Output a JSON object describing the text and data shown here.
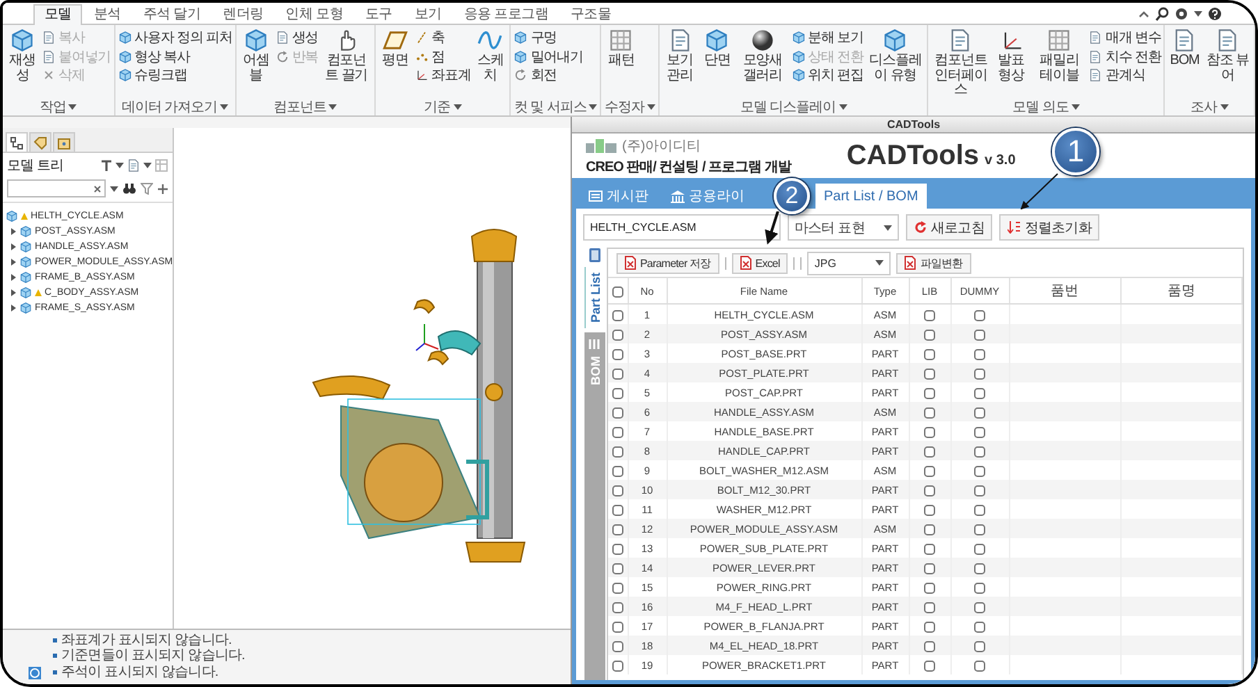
{
  "ribbon": {
    "tabs": [
      {
        "label": "모델",
        "selected": true
      },
      {
        "label": "분석",
        "selected": false
      },
      {
        "label": "주석 달기",
        "selected": false
      },
      {
        "label": "렌더링",
        "selected": false
      },
      {
        "label": "인체 모형",
        "selected": false
      },
      {
        "label": "도구",
        "selected": false
      },
      {
        "label": "보기",
        "selected": false
      },
      {
        "label": "응용 프로그램",
        "selected": false
      },
      {
        "label": "구조물",
        "selected": false
      }
    ],
    "groups": [
      {
        "label": "작업",
        "items": [
          {
            "kind": "large",
            "label": "재생성",
            "disabled": false
          },
          {
            "kind": "stack",
            "items": [
              {
                "label": "복사",
                "disabled": true
              },
              {
                "label": "붙여넣기",
                "disabled": true
              },
              {
                "label": "삭제",
                "disabled": true
              }
            ]
          }
        ]
      },
      {
        "label": "데이터 가져오기",
        "items": [
          {
            "kind": "stack",
            "items": [
              {
                "label": "사용자 정의 피처",
                "disabled": false
              },
              {
                "label": "형상 복사",
                "disabled": false
              },
              {
                "label": "슈링크랩",
                "disabled": false
              }
            ]
          }
        ]
      },
      {
        "label": "컴포넌트",
        "items": [
          {
            "kind": "large",
            "label": "어셈블",
            "disabled": false
          },
          {
            "kind": "stack",
            "items": [
              {
                "label": "생성",
                "disabled": false
              },
              {
                "label": "반복",
                "disabled": true
              }
            ]
          },
          {
            "kind": "large",
            "label": "컴포넌트 끌기",
            "disabled": false
          }
        ]
      },
      {
        "label": "기준",
        "items": [
          {
            "kind": "large",
            "label": "평면",
            "disabled": false
          },
          {
            "kind": "stack",
            "items": [
              {
                "label": "축",
                "disabled": false
              },
              {
                "label": "점",
                "disabled": false
              },
              {
                "label": "좌표계",
                "disabled": false
              }
            ]
          },
          {
            "kind": "large",
            "label": "스케치",
            "disabled": false
          }
        ]
      },
      {
        "label": "컷 및 서피스",
        "items": [
          {
            "kind": "stack",
            "items": [
              {
                "label": "구멍",
                "disabled": false
              },
              {
                "label": "밀어내기",
                "disabled": false
              },
              {
                "label": "회전",
                "disabled": false
              }
            ]
          }
        ]
      },
      {
        "label": "수정자",
        "items": [
          {
            "kind": "large",
            "label": "패턴",
            "disabled": false
          }
        ]
      },
      {
        "label": "모델 디스플레이",
        "items": [
          {
            "kind": "large",
            "label": "보기 관리",
            "disabled": false
          },
          {
            "kind": "large",
            "label": "단면",
            "disabled": false
          },
          {
            "kind": "large",
            "label": "모양새 갤러리",
            "disabled": false
          },
          {
            "kind": "stack",
            "items": [
              {
                "label": "분해 보기",
                "disabled": false
              },
              {
                "label": "상태 전환",
                "disabled": true
              },
              {
                "label": "위치 편집",
                "disabled": false
              }
            ]
          },
          {
            "kind": "large",
            "label": "디스플레이 유형",
            "disabled": false
          }
        ]
      },
      {
        "label": "모델 의도",
        "items": [
          {
            "kind": "large",
            "label": "컴포넌트 인터페이스",
            "disabled": false
          },
          {
            "kind": "large",
            "label": "발표 형상",
            "disabled": false
          },
          {
            "kind": "large",
            "label": "패밀리 테이블",
            "disabled": false
          },
          {
            "kind": "stack",
            "items": [
              {
                "label": "매개 변수",
                "disabled": false
              },
              {
                "label": "치수 전환",
                "disabled": false
              },
              {
                "label": "관계식",
                "disabled": false
              }
            ]
          }
        ]
      },
      {
        "label": "조사",
        "items": [
          {
            "kind": "large",
            "label": "BOM",
            "disabled": false
          },
          {
            "kind": "large",
            "label": "참조 뷰어",
            "disabled": false
          }
        ]
      }
    ]
  },
  "model_tree": {
    "panel_tabs": [
      {
        "selected": true
      },
      {
        "selected": false
      },
      {
        "selected": false
      }
    ],
    "title": "모델 트리",
    "root": {
      "label": "HELTH_CYCLE.ASM",
      "warning": true,
      "children": [
        {
          "label": "POST_ASSY.ASM",
          "warning": false,
          "expanded": false
        },
        {
          "label": "HANDLE_ASSY.ASM",
          "warning": false,
          "expanded": false
        },
        {
          "label": "POWER_MODULE_ASSY.ASM",
          "warning": false,
          "expanded": false
        },
        {
          "label": "FRAME_B_ASSY.ASM",
          "warning": false,
          "expanded": false
        },
        {
          "label": "C_BODY_ASSY.ASM",
          "warning": true,
          "expanded": false
        },
        {
          "label": "FRAME_S_ASSY.ASM",
          "warning": false,
          "expanded": false
        }
      ]
    }
  },
  "status_messages": [
    "좌표계가 표시되지 않습니다.",
    "기준면들이 표시되지 않습니다.",
    "주석이 표시되지 않습니다."
  ],
  "cadtools": {
    "window_title": "CADTools",
    "company": "(주)아이디티",
    "tagline": "CREO 판매/ 컨설팅 / 프로그램 개발",
    "app_name": "CADTools",
    "version": "v 3.0",
    "tabs": [
      {
        "label": "게시판",
        "selected": false
      },
      {
        "label": "공용라이",
        "selected": false
      },
      {
        "label": "Part List / BOM",
        "selected": true
      }
    ],
    "file_field": {
      "value": "HELTH_CYCLE.ASM"
    },
    "representation": {
      "value": "마스터 표현"
    },
    "buttons": [
      "새로고침",
      "정렬초기화"
    ],
    "side_tabs": [
      {
        "label": "Part List",
        "selected": true
      },
      {
        "label": "BOM",
        "selected": false
      }
    ],
    "toolbar": {
      "save_button": "Parameter 저장",
      "excel_button": "Excel",
      "format": {
        "value": "JPG"
      },
      "convert_button": "파일변환"
    },
    "table": {
      "header_checked": false,
      "columns": [
        "No",
        "File Name",
        "Type",
        "LIB",
        "DUMMY",
        "품번",
        "품명"
      ],
      "rows": [
        {
          "no": "1",
          "file_name": "HELTH_CYCLE.ASM",
          "type": "ASM",
          "checked": false,
          "lib": false,
          "dummy": false
        },
        {
          "no": "2",
          "file_name": "POST_ASSY.ASM",
          "type": "ASM",
          "checked": false,
          "lib": false,
          "dummy": false
        },
        {
          "no": "3",
          "file_name": "POST_BASE.PRT",
          "type": "PART",
          "checked": false,
          "lib": false,
          "dummy": false
        },
        {
          "no": "4",
          "file_name": "POST_PLATE.PRT",
          "type": "PART",
          "checked": false,
          "lib": false,
          "dummy": false
        },
        {
          "no": "5",
          "file_name": "POST_CAP.PRT",
          "type": "PART",
          "checked": false,
          "lib": false,
          "dummy": false
        },
        {
          "no": "6",
          "file_name": "HANDLE_ASSY.ASM",
          "type": "ASM",
          "checked": false,
          "lib": false,
          "dummy": false
        },
        {
          "no": "7",
          "file_name": "HANDLE_BASE.PRT",
          "type": "PART",
          "checked": false,
          "lib": false,
          "dummy": false
        },
        {
          "no": "8",
          "file_name": "HANDLE_CAP.PRT",
          "type": "PART",
          "checked": false,
          "lib": false,
          "dummy": false
        },
        {
          "no": "9",
          "file_name": "BOLT_WASHER_M12.ASM",
          "type": "ASM",
          "checked": false,
          "lib": false,
          "dummy": false
        },
        {
          "no": "10",
          "file_name": "BOLT_M12_30.PRT",
          "type": "PART",
          "checked": false,
          "lib": false,
          "dummy": false
        },
        {
          "no": "11",
          "file_name": "WASHER_M12.PRT",
          "type": "PART",
          "checked": false,
          "lib": false,
          "dummy": false
        },
        {
          "no": "12",
          "file_name": "POWER_MODULE_ASSY.ASM",
          "type": "ASM",
          "checked": false,
          "lib": false,
          "dummy": false
        },
        {
          "no": "13",
          "file_name": "POWER_SUB_PLATE.PRT",
          "type": "PART",
          "checked": false,
          "lib": false,
          "dummy": false
        },
        {
          "no": "14",
          "file_name": "POWER_LEVER.PRT",
          "type": "PART",
          "checked": false,
          "lib": false,
          "dummy": false
        },
        {
          "no": "15",
          "file_name": "POWER_RING.PRT",
          "type": "PART",
          "checked": false,
          "lib": false,
          "dummy": false
        },
        {
          "no": "16",
          "file_name": "M4_F_HEAD_L.PRT",
          "type": "PART",
          "checked": false,
          "lib": false,
          "dummy": false
        },
        {
          "no": "17",
          "file_name": "POWER_B_FLANJA.PRT",
          "type": "PART",
          "checked": false,
          "lib": false,
          "dummy": false
        },
        {
          "no": "18",
          "file_name": "M4_EL_HEAD_18.PRT",
          "type": "PART",
          "checked": false,
          "lib": false,
          "dummy": false
        },
        {
          "no": "19",
          "file_name": "POWER_BRACKET1.PRT",
          "type": "PART",
          "checked": false,
          "lib": false,
          "dummy": false
        }
      ]
    }
  },
  "callouts": [
    {
      "label": "1"
    },
    {
      "label": "2"
    }
  ]
}
